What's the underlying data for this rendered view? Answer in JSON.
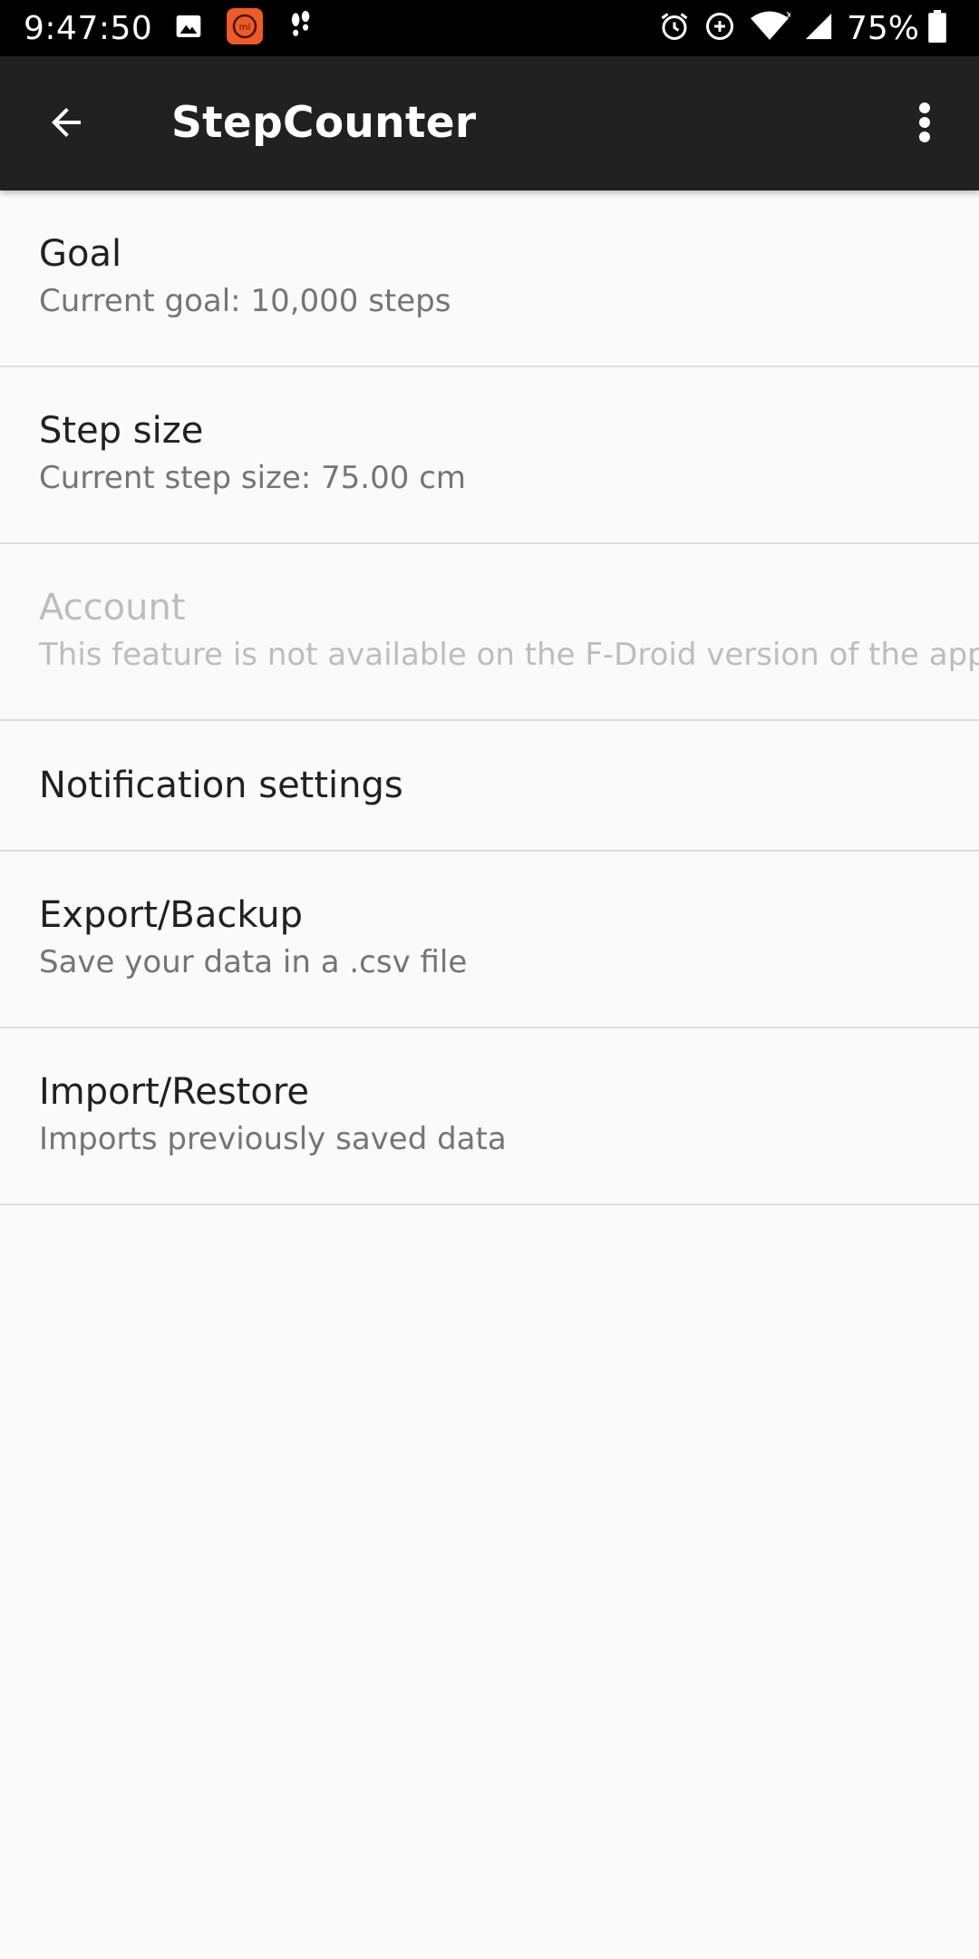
{
  "status_bar": {
    "time": "9:47:50",
    "battery": "75%",
    "icons_left": [
      "image-icon",
      "mi-app-icon",
      "footsteps-icon"
    ],
    "icons_right": [
      "alarm-icon",
      "data-saver-icon",
      "wifi-icon",
      "cell-signal-icon",
      "battery-icon"
    ]
  },
  "app_bar": {
    "title": "StepCounter",
    "back_icon": "arrow-back-icon",
    "menu_icon": "more-vert-icon",
    "background": "#212121"
  },
  "preferences": [
    {
      "title": "Goal",
      "summary": "Current goal: 10,000 steps",
      "enabled": true
    },
    {
      "title": "Step size",
      "summary": "Current step size: 75.00 cm",
      "enabled": true
    },
    {
      "title": "Account",
      "summary": "This feature is not available on the F-Droid version of the app",
      "enabled": false
    },
    {
      "title": "Notification settings",
      "enabled": true
    },
    {
      "title": "Export/Backup",
      "summary": "Save your data in a .csv file",
      "enabled": true
    },
    {
      "title": "Import/Restore",
      "summary": "Imports previously saved data",
      "enabled": true
    }
  ]
}
